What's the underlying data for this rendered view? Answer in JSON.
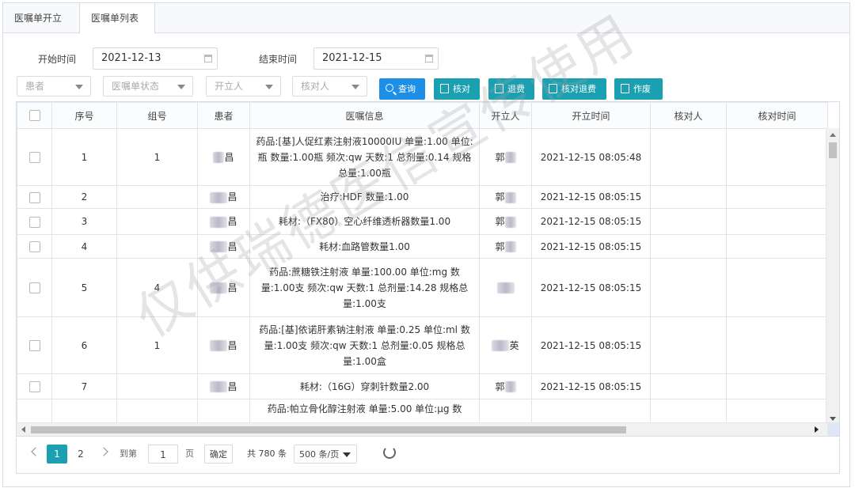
{
  "tabs": [
    {
      "label": "医嘱单开立"
    },
    {
      "label": "医嘱单列表"
    }
  ],
  "filters": {
    "start_label": "开始时间",
    "start_value": "2021-12-13",
    "end_label": "结束时间",
    "end_value": "2021-12-15",
    "patient_placeholder": "患者",
    "status_placeholder": "医嘱单状态",
    "issuer_placeholder": "开立人",
    "checker_placeholder": "核对人"
  },
  "buttons": {
    "query": "查询",
    "check": "核对",
    "return": "退费",
    "check_return": "核对退费",
    "void": "作废"
  },
  "columns": [
    "",
    "序号",
    "组号",
    "患者",
    "医嘱信息",
    "开立人",
    "开立时间",
    "核对人",
    "核对时间"
  ],
  "rows": [
    {
      "no": "1",
      "group": "1",
      "patient": "昌",
      "info": "药品:[基]人促红素注射液10000IU 单量:1.00 单位:瓶 数量:1.00瓶 频次:qw 天数:1 总剂量:0.14 规格总量:1.00瓶",
      "issuer": "郭",
      "time": "2021-12-15 08:05:48"
    },
    {
      "no": "2",
      "group": "",
      "patient": "昌",
      "info": "治疗:HDF 数量:1.00",
      "issuer": "郭",
      "time": "2021-12-15 08:05:15"
    },
    {
      "no": "3",
      "group": "",
      "patient": "昌",
      "info": "耗材:（FX80）空心纤维透析器数量1.00",
      "issuer": "郭",
      "time": "2021-12-15 08:05:15"
    },
    {
      "no": "4",
      "group": "",
      "patient": "昌",
      "info": "耗材:血路管数量1.00",
      "issuer": "郭",
      "time": "2021-12-15 08:05:15"
    },
    {
      "no": "5",
      "group": "4",
      "patient": "昌",
      "info": "药品:蔗糖铁注射液 单量:100.00 单位:mg 数量:1.00支 频次:qw 天数:1 总剂量:14.28 规格总量:1.00支",
      "issuer": "",
      "time": "2021-12-15 08:05:15"
    },
    {
      "no": "6",
      "group": "1",
      "patient": "昌",
      "info": "药品:[基]依诺肝素钠注射液 单量:0.25 单位:ml 数量:1.00支 频次:qw 天数:1 总剂量:0.05 规格总量:1.00盒",
      "issuer": "英",
      "time": "2021-12-15 08:05:15"
    },
    {
      "no": "7",
      "group": "",
      "patient": "昌",
      "info": "耗材:（16G）穿刺针数量2.00",
      "issuer": "郭",
      "time": "2021-12-15 08:05:15"
    },
    {
      "no": "",
      "group": "",
      "patient": "",
      "info": "药品:帕立骨化醇注射液 单量:5.00 单位:μg 数",
      "issuer": "",
      "time": ""
    }
  ],
  "pager": {
    "prev": "<",
    "page1": "1",
    "page2": "2",
    "next": ">",
    "goto_label": "到第",
    "goto_value": "1",
    "page_unit": "页",
    "confirm": "确定",
    "total": "共 780 条",
    "page_size": "500 条/页"
  },
  "watermark": "仅供瑞德医信宣传使用"
}
